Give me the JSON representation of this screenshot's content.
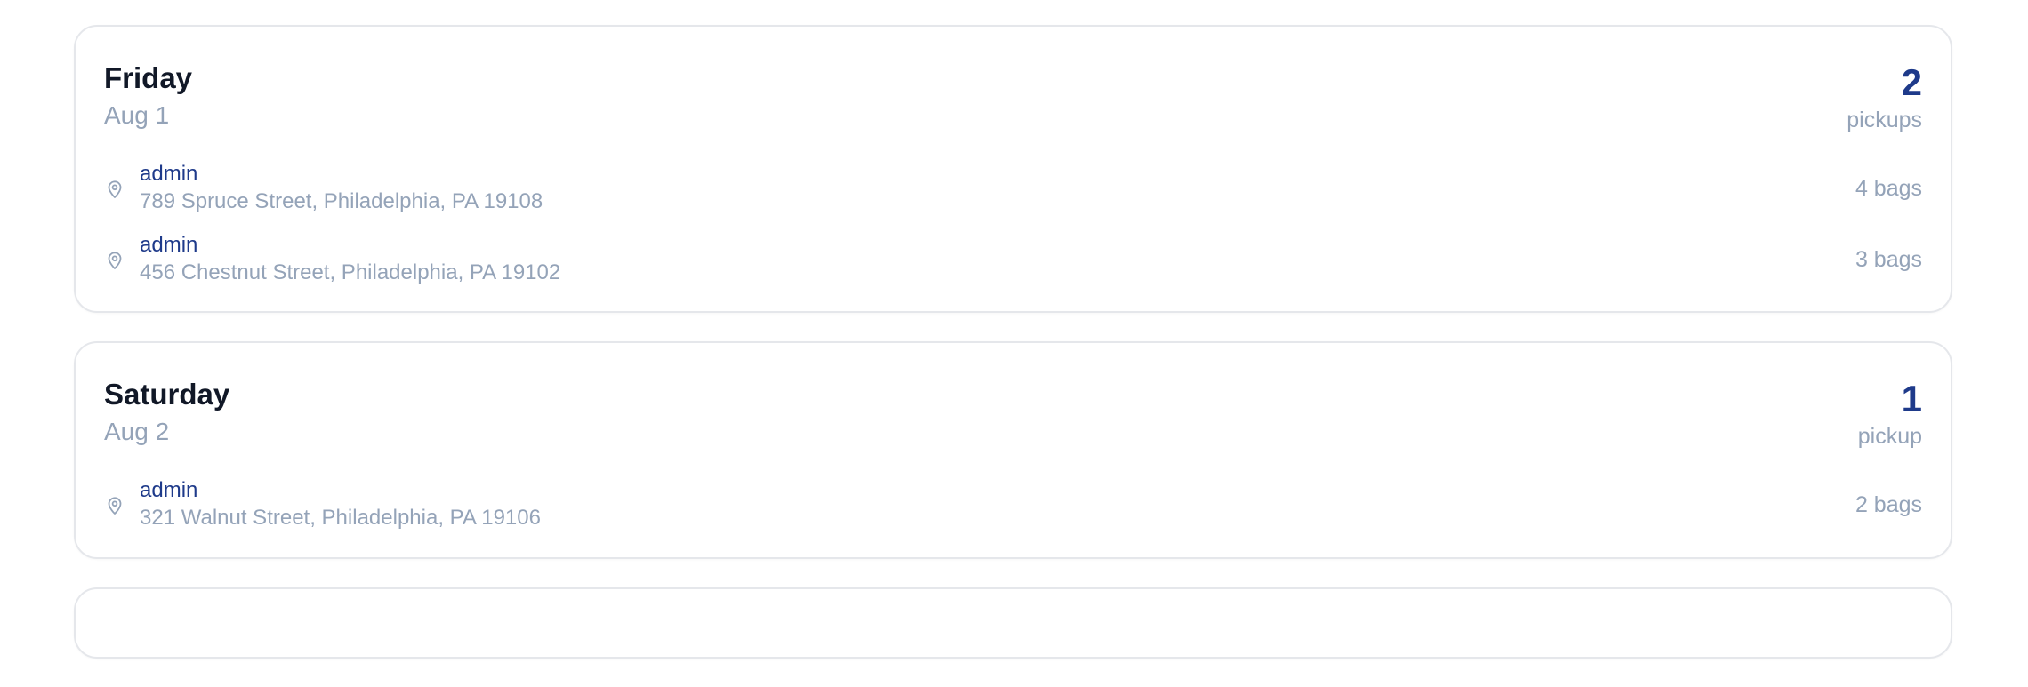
{
  "days": [
    {
      "name": "Friday",
      "date": "Aug 1",
      "count": "2",
      "count_label": "pickups",
      "pickups": [
        {
          "user": "admin",
          "address": "789 Spruce Street, Philadelphia, PA 19108",
          "bags": "4 bags"
        },
        {
          "user": "admin",
          "address": "456 Chestnut Street, Philadelphia, PA 19102",
          "bags": "3 bags"
        }
      ]
    },
    {
      "name": "Saturday",
      "date": "Aug 2",
      "count": "1",
      "count_label": "pickup",
      "pickups": [
        {
          "user": "admin",
          "address": "321 Walnut Street, Philadelphia, PA 19106",
          "bags": "2 bags"
        }
      ]
    }
  ],
  "icons": {
    "pickup": "location-pin-icon"
  },
  "colors": {
    "accent": "#1e3a8a",
    "muted": "#94a3b8",
    "border": "#e5e7eb"
  }
}
